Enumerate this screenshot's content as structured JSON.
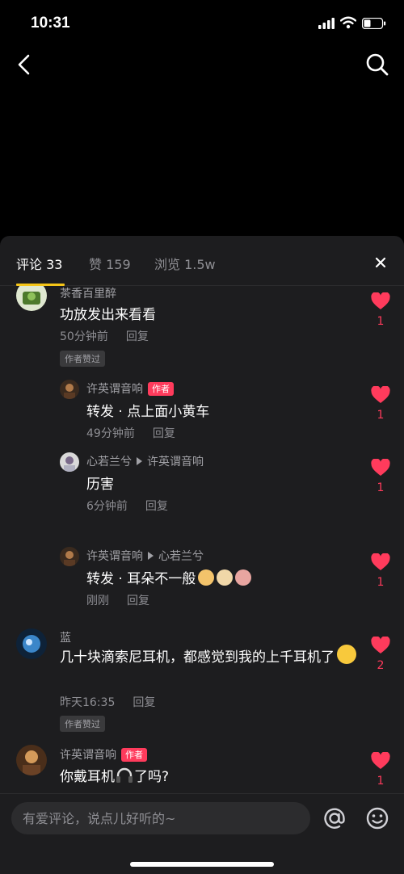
{
  "status_bar": {
    "time": "10:31"
  },
  "tabs": {
    "comments": "评论 33",
    "likes": "赞 159",
    "views": "浏览 1.5w"
  },
  "comments": [
    {
      "user": "茶香百里醉",
      "text": "功放发出来看看",
      "time": "50分钟前",
      "reply": "回复",
      "liked_tag": "作者赞过",
      "likes": "1"
    },
    {
      "user": "许英谓音响",
      "author_tag": "作者",
      "text": "转发 · 点上面小黄车",
      "time": "49分钟前",
      "reply": "回复",
      "likes": "1"
    },
    {
      "user": "心若兰兮",
      "reply_to": "许英谓音响",
      "text": "历害",
      "time": "6分钟前",
      "reply": "回复",
      "likes": "1"
    },
    {
      "user": "许英谓音响",
      "reply_to": "心若兰兮",
      "text": "转发 · 耳朵不一般",
      "time": "刚刚",
      "reply": "回复",
      "likes": "1"
    },
    {
      "user": "蓝",
      "text": "几十块滴索尼耳机，都感觉到我的上千耳机了",
      "time": "昨天16:35",
      "reply": "回复",
      "liked_tag": "作者赞过",
      "likes": "2"
    },
    {
      "user": "许英谓音响",
      "author_tag": "作者",
      "text_before": "你戴耳机",
      "text_after": "了吗?",
      "likes": "1"
    }
  ],
  "input": {
    "placeholder": "有爱评论，说点儿好听的~"
  },
  "colors": {
    "accent": "#ff3b5c",
    "tab_indicator": "#f5c518",
    "sheet_bg": "#1d1d1f"
  },
  "icons": [
    "back-icon",
    "search-icon",
    "close-icon",
    "heart-icon",
    "at-icon",
    "emoji-icon",
    "signal-icon",
    "wifi-icon",
    "battery-icon"
  ]
}
